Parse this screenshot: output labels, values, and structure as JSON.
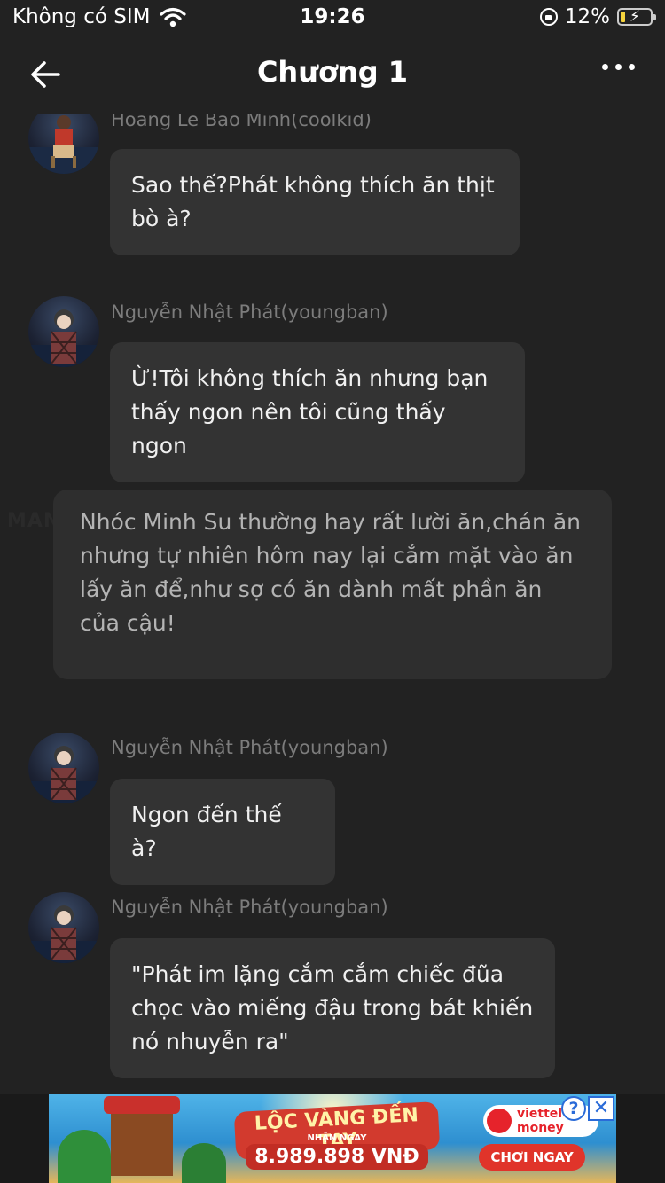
{
  "status_bar": {
    "carrier": "Không có SIM",
    "time": "19:26",
    "battery": "12%"
  },
  "nav": {
    "title": "Chương 1",
    "back_icon": "arrow-left-icon",
    "more_icon": "more-horizontal-icon"
  },
  "messages": [
    {
      "author": "Hoang Le Bao Minh(coolkid)",
      "text": "Sao thế?Phát không thích ăn thịt bò à?"
    },
    {
      "author": "Nguyễn Nhật Phát(youngban)",
      "text": "Ừ!Tôi không thích ăn nhưng bạn thấy ngon nên tôi cũng thấy ngon"
    },
    {
      "narration": "Nhóc Minh Su thường hay rất lười ăn,chán ăn nhưng tự nhiên hôm nay lại cắm mặt vào ăn lấy ăn để,như sợ có ăn dành mất phần ăn của cậu!"
    },
    {
      "author": "Nguyễn Nhật Phát(youngban)",
      "text": "Ngon đến thế à?"
    },
    {
      "author": "Nguyễn Nhật Phát(youngban)",
      "text": "\"Phát im lặng cắm cắm chiếc đũa chọc vào miếng đậu trong bát khiến nó nhuyễn ra\""
    }
  ],
  "watermark": "MANGA TOON",
  "ad": {
    "headline": "LỘC VÀNG ĐẾN TAY",
    "sub": "NHẬN NGAY",
    "amount": "8.989.898 VNĐ",
    "brand": "viettel money",
    "cta": "CHƠI NGAY",
    "help_label": "?",
    "close_label": "✕"
  },
  "colors": {
    "background": "#222222",
    "bubble": "#333333",
    "narration": "#2e2e2e",
    "author_text": "#7c7c7c"
  }
}
